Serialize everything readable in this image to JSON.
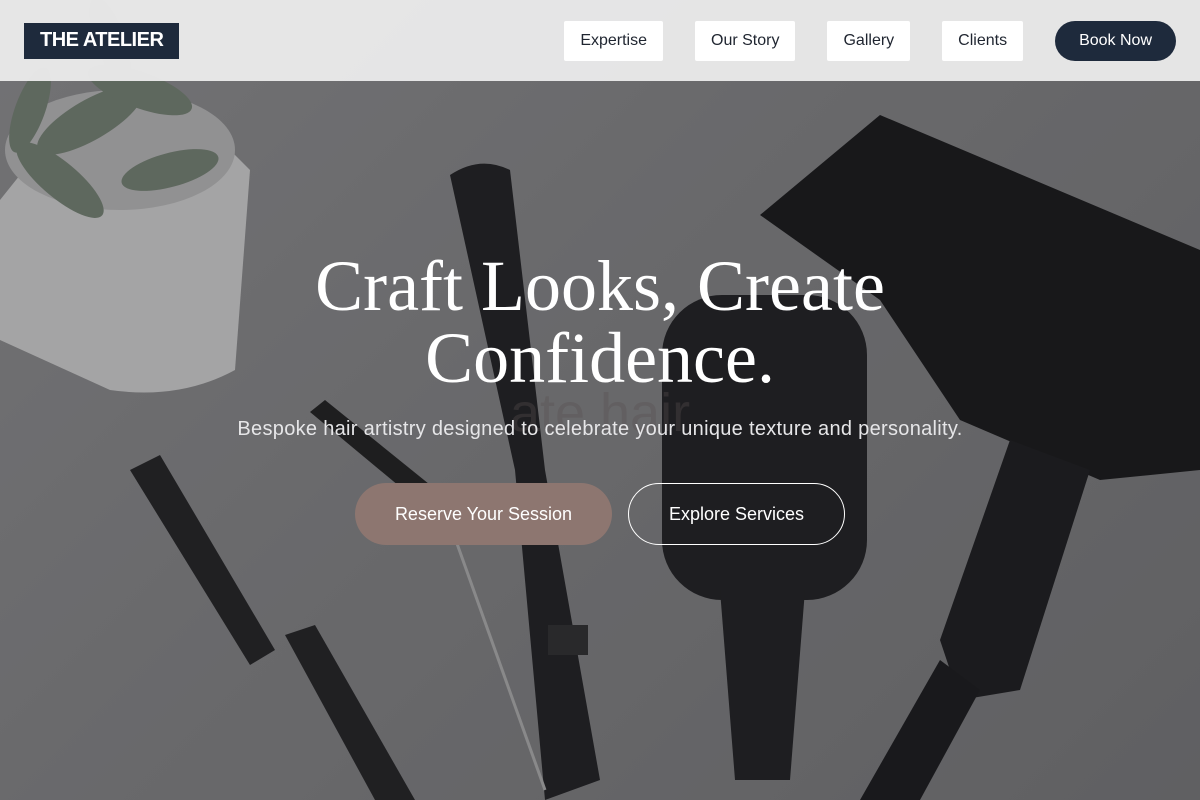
{
  "brand": {
    "logo_text": "THE ATELIER"
  },
  "nav": {
    "items": [
      {
        "label": "Expertise"
      },
      {
        "label": "Our Story"
      },
      {
        "label": "Gallery"
      },
      {
        "label": "Clients"
      }
    ],
    "book_label": "Book Now"
  },
  "hero": {
    "headline": "Craft Looks, Create Confidence.",
    "ghost_text": "ate hair",
    "subtext": "Bespoke hair artistry designed to celebrate your unique texture and personality.",
    "primary_cta": "Reserve Your Session",
    "secondary_cta": "Explore Services"
  },
  "colors": {
    "brand_navy": "#1e2a3c",
    "accent_mauve": "#8d7670",
    "nav_bg": "#ececec"
  }
}
